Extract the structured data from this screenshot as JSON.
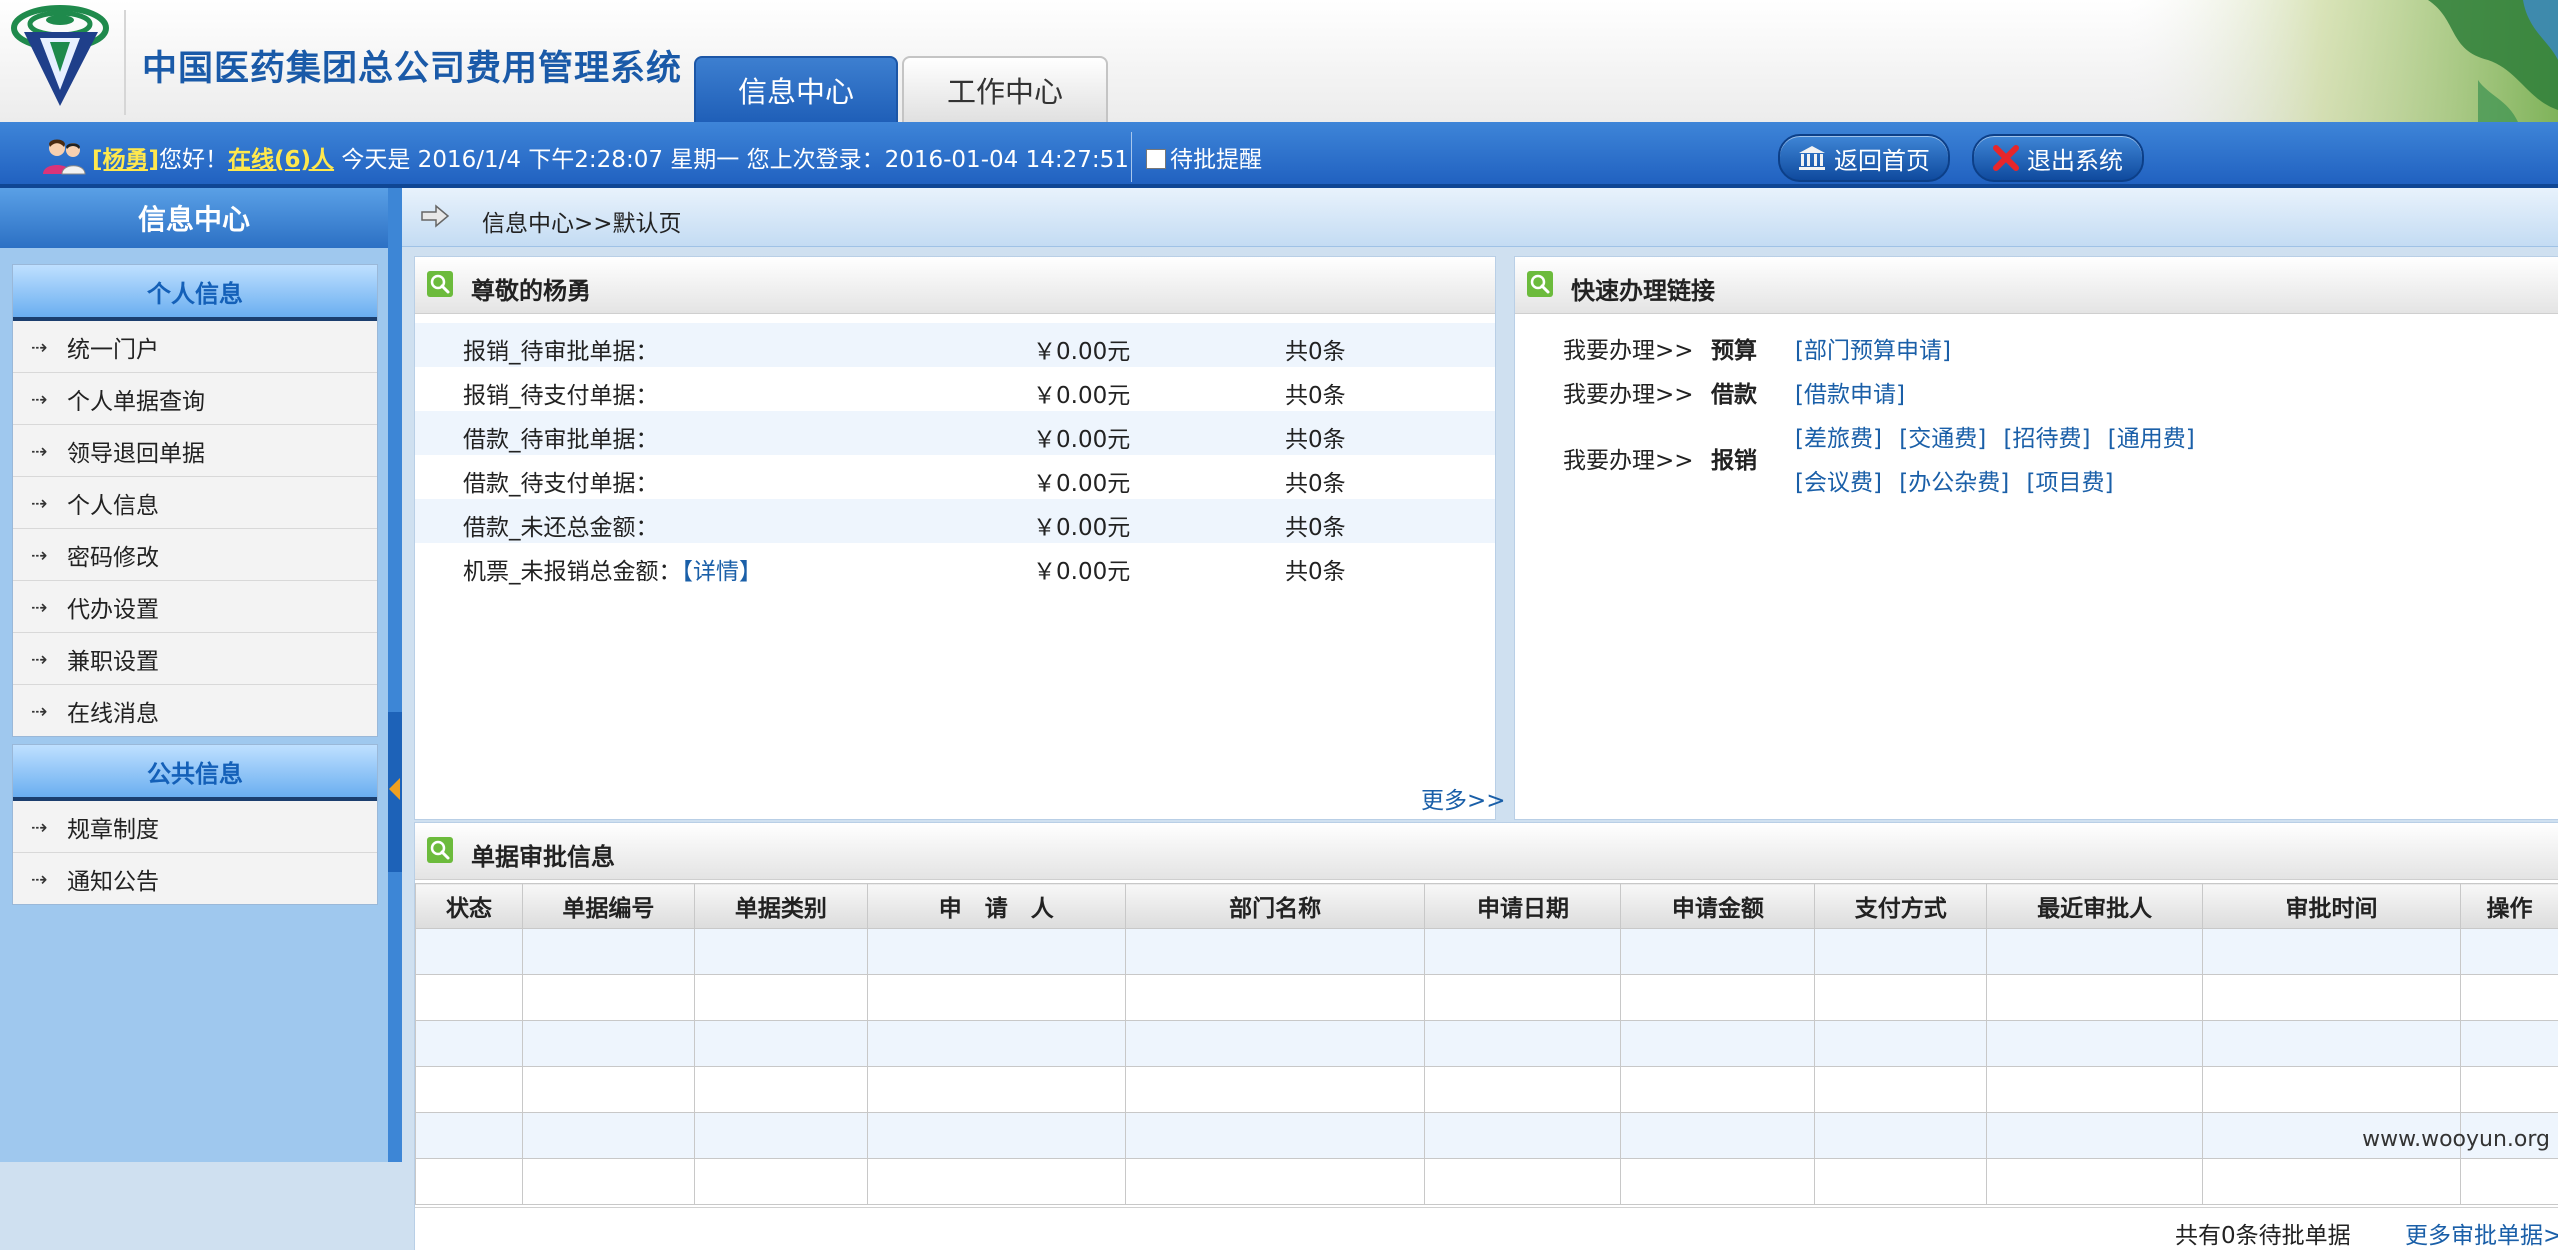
{
  "header": {
    "system_title": "中国医药集团总公司费用管理系统",
    "tabs": [
      {
        "label": "信息中心"
      },
      {
        "label": "工作中心"
      }
    ]
  },
  "userbar": {
    "user_name": "[杨勇]",
    "greeting": "您好！",
    "online": "在线(6)人",
    "today": "今天是 2016/1/4 下午2:28:07 星期一",
    "last_login": "您上次登录：2016-01-04 14:27:51",
    "pending_reminder": "待批提醒",
    "home_button": "返回首页",
    "exit_button": "退出系统"
  },
  "sidebar": {
    "title": "信息中心",
    "personal": {
      "heading": "个人信息",
      "items": [
        {
          "label": "统一门户"
        },
        {
          "label": "个人单据查询"
        },
        {
          "label": "领导退回单据"
        },
        {
          "label": "个人信息"
        },
        {
          "label": "密码修改"
        },
        {
          "label": "代办设置"
        },
        {
          "label": "兼职设置"
        },
        {
          "label": "在线消息"
        }
      ]
    },
    "public": {
      "heading": "公共信息",
      "items": [
        {
          "label": "规章制度"
        },
        {
          "label": "通知公告"
        }
      ]
    }
  },
  "breadcrumb": "信息中心>>默认页",
  "pending_panel": {
    "title": "尊敬的杨勇",
    "rows": [
      {
        "label": "报销_待审批单据：",
        "amount": "￥0.00元",
        "count": "共0条"
      },
      {
        "label": "报销_待支付单据：",
        "amount": "￥0.00元",
        "count": "共0条"
      },
      {
        "label": "借款_待审批单据：",
        "amount": "￥0.00元",
        "count": "共0条"
      },
      {
        "label": "借款_待支付单据：",
        "amount": "￥0.00元",
        "count": "共0条"
      },
      {
        "label": "借款_未还总金额：",
        "amount": "￥0.00元",
        "count": "共0条"
      },
      {
        "label": "机票_未报销总金额：",
        "detail": "【详情】",
        "amount": "￥0.00元",
        "count": "共0条"
      }
    ],
    "more": "更多>>"
  },
  "quick_links": {
    "title": "快速办理链接",
    "prefix": "我要办理>>",
    "groups": [
      {
        "category": "预算",
        "line1": [
          "[部门预算申请]"
        ]
      },
      {
        "category": "借款",
        "line1": [
          "[借款申请]"
        ]
      },
      {
        "category": "报销",
        "line1": [
          "[差旅费]",
          "[交通费]",
          "[招待费]",
          "[通用费]"
        ],
        "line2": [
          "[会议费]",
          "[办公杂费]",
          "[项目费]"
        ]
      }
    ]
  },
  "approval_panel": {
    "title": "单据审批信息",
    "columns": [
      "状态",
      "单据编号",
      "单据类别",
      "申　请　人",
      "部门名称",
      "申请日期",
      "申请金额",
      "支付方式",
      "最近审批人",
      "审批时间",
      "操作"
    ],
    "empty_rows": 6,
    "total": "共有0条待批单据",
    "more": "更多审批单据>>"
  },
  "watermark": "www.wooyun.org",
  "colors": {
    "header_blue": "#1f5fbf",
    "title_blue": "#1a5aa8",
    "link_blue": "#1a5fa8",
    "username_yellow": "#ffe84d",
    "sidebar_bg": "#9fc8ee"
  }
}
